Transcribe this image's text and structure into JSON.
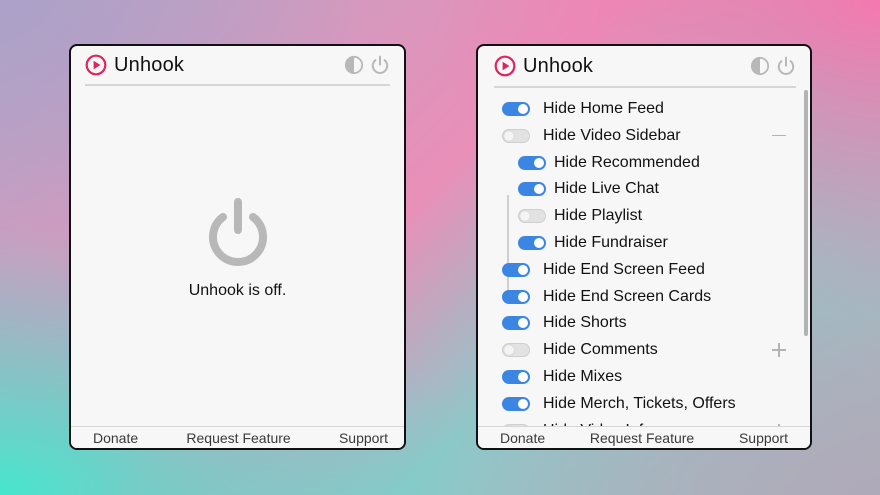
{
  "left_popup": {
    "title": "Unhook",
    "status_text": "Unhook is off.",
    "footer": {
      "donate": "Donate",
      "request": "Request Feature",
      "support": "Support"
    }
  },
  "right_popup": {
    "title": "Unhook",
    "settings": [
      {
        "label": "Hide Home Feed",
        "on": true,
        "sub": false
      },
      {
        "label": "Hide Video Sidebar",
        "on": false,
        "sub": false,
        "expander": "minus"
      },
      {
        "label": "Hide Recommended",
        "on": true,
        "sub": true
      },
      {
        "label": "Hide Live Chat",
        "on": true,
        "sub": true
      },
      {
        "label": "Hide Playlist",
        "on": false,
        "sub": true
      },
      {
        "label": "Hide Fundraiser",
        "on": true,
        "sub": true
      },
      {
        "label": "Hide End Screen Feed",
        "on": true,
        "sub": false
      },
      {
        "label": "Hide End Screen Cards",
        "on": true,
        "sub": false
      },
      {
        "label": "Hide Shorts",
        "on": true,
        "sub": false
      },
      {
        "label": "Hide Comments",
        "on": false,
        "sub": false,
        "expander": "plus"
      },
      {
        "label": "Hide Mixes",
        "on": true,
        "sub": false
      },
      {
        "label": "Hide Merch, Tickets, Offers",
        "on": true,
        "sub": false
      },
      {
        "label": "Hide Video Info",
        "on": false,
        "sub": false,
        "expander": "plus"
      }
    ],
    "footer": {
      "donate": "Donate",
      "request": "Request Feature",
      "support": "Support"
    }
  },
  "colors": {
    "brand_red": "#e0245e",
    "toggle_on": "#3b86e3",
    "icon_gray": "#b8b8b8"
  },
  "icons": {
    "logo": "play-circle-icon",
    "theme": "contrast-icon",
    "power": "power-icon"
  }
}
